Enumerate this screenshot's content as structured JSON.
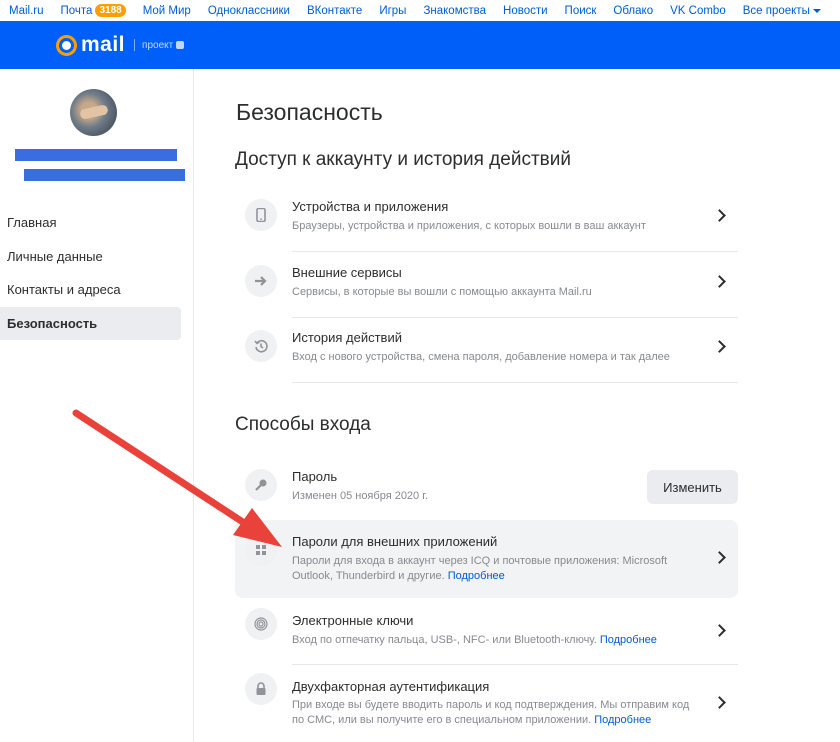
{
  "portal": {
    "links": [
      "Mail.ru",
      "Почта",
      "Мой Мир",
      "Одноклассники",
      "ВКонтакте",
      "Игры",
      "Знакомства",
      "Новости",
      "Поиск",
      "Облако",
      "VK Combo",
      "Все проекты"
    ],
    "mail_badge": "3188"
  },
  "header": {
    "logo_text": "mail",
    "project_label": "проект"
  },
  "sidebar": {
    "items": [
      {
        "label": "Главная",
        "active": false
      },
      {
        "label": "Личные данные",
        "active": false
      },
      {
        "label": "Контакты и адреса",
        "active": false
      },
      {
        "label": "Безопасность",
        "active": true
      }
    ]
  },
  "main": {
    "page_title": "Безопасность",
    "access_section": {
      "title": "Доступ к аккаунту и история действий",
      "rows": [
        {
          "title": "Устройства и приложения",
          "sub": "Браузеры, устройства и приложения, с которых вошли в ваш аккаунт",
          "icon": "phone-icon"
        },
        {
          "title": "Внешние сервисы",
          "sub": "Сервисы, в которые вы вошли с помощью аккаунта Mail.ru",
          "icon": "arrow-right-icon"
        },
        {
          "title": "История действий",
          "sub": "Вход с нового устройства, смена пароля, добавление номера и так далее",
          "icon": "history-icon"
        }
      ]
    },
    "login_section": {
      "title": "Способы входа",
      "password": {
        "title": "Пароль",
        "sub": "Изменен 05 ноября 2020 г.",
        "button": "Изменить",
        "icon": "key-icon"
      },
      "app_passwords": {
        "title": "Пароли для внешних приложений",
        "sub": "Пароли для входа в аккаунт через ICQ и почтовые приложения: Microsoft Outlook, Thunderbird и другие.",
        "link": "Подробнее",
        "icon": "apps-icon"
      },
      "keys": {
        "title": "Электронные ключи",
        "sub": "Вход по отпечатку пальца, USB-, NFC- или Bluetooth-ключу.",
        "link": "Подробнее",
        "icon": "fingerprint-icon"
      },
      "twofa": {
        "title": "Двухфакторная аутентификация",
        "sub": "При входе вы будете вводить пароль и код подтверждения. Мы отправим код по СМС, или вы получите его в специальном приложении.",
        "link": "Подробнее",
        "icon": "lock-icon"
      }
    }
  },
  "colors": {
    "header_blue": "#005ff9",
    "link_blue": "#005bd1",
    "badge_orange": "#ff9e00",
    "arrow_red": "#e8423b"
  }
}
